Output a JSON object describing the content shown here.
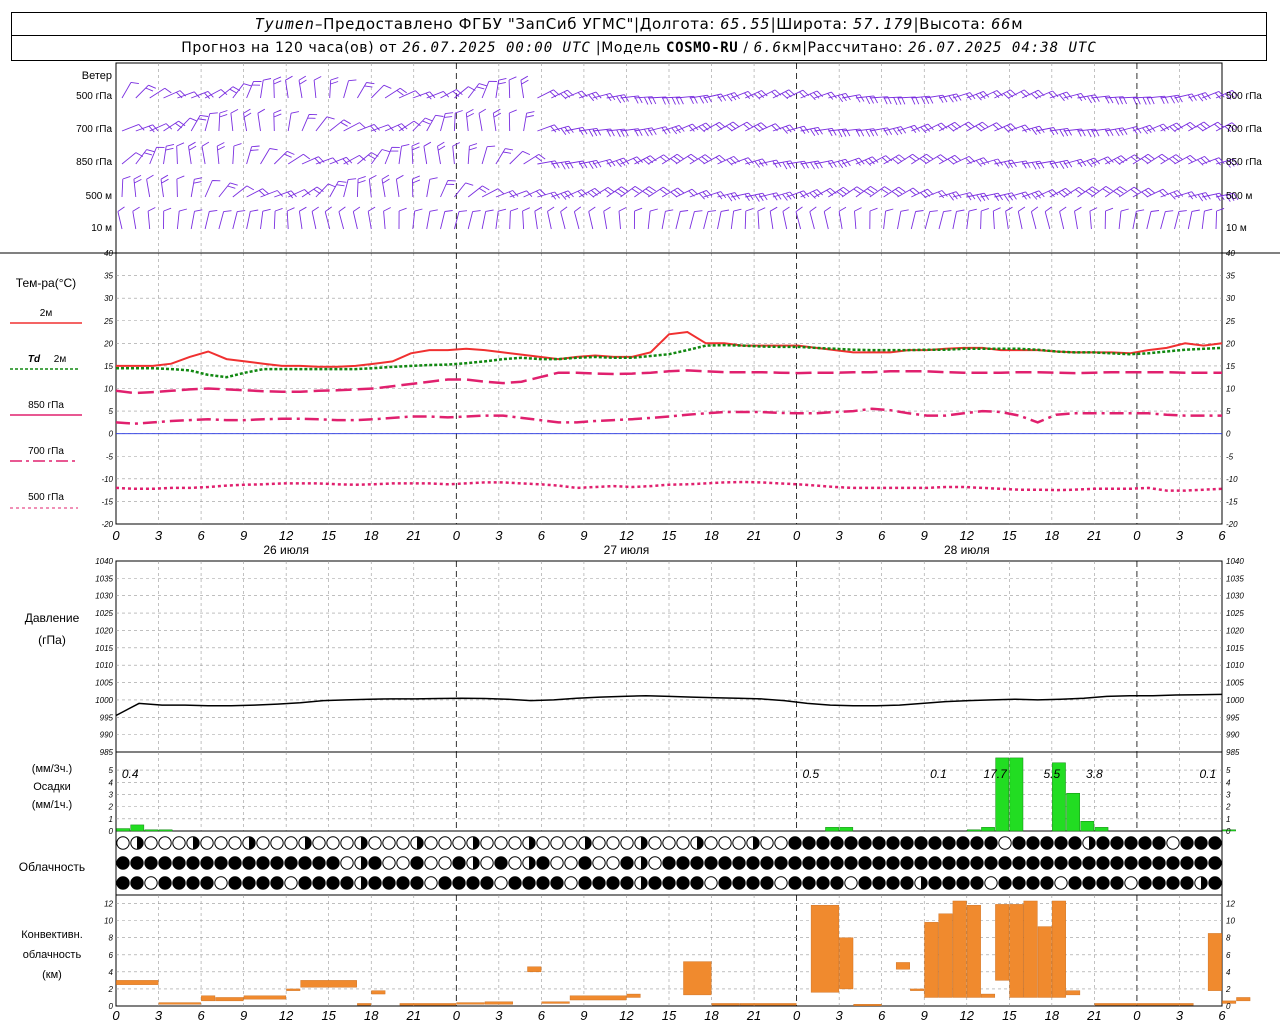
{
  "header": {
    "station": "Tyumen",
    "dash": " – ",
    "provider": "Предоставлено ФГБУ \"ЗапСиб УГМС\"",
    "lon_label": "Долгота:",
    "lon": "65.55",
    "lat_label": "Широта:",
    "lat": "57.179",
    "alt_label": "Высота:",
    "alt": "66",
    "alt_unit": "м",
    "sep": " | ",
    "forecast_label": "Прогноз на 120 часа(ов) от",
    "forecast_time": "26.07.2025 00:00 UTC",
    "model_label": "Модель",
    "model": "COSMO-RU",
    "resolution": "6.6",
    "res_unit": "км",
    "computed_label": "Рассчитано:",
    "computed_time": "26.07.2025 04:38 UTC"
  },
  "labels": {
    "wind": "Ветер",
    "wind_levels": [
      "500 гПа",
      "700 гПа",
      "850 гПа",
      "500 м",
      "10  м"
    ],
    "temp_title": "Тем-ра(°С)",
    "t2m": "2м",
    "td_a": "Td",
    "td_b": "2м",
    "t850": "850 гПа",
    "t700": "700 гПа",
    "t500": "500 гПа",
    "pressure_a": "Давление",
    "pressure_b": "(гПа)",
    "precip_a": "(мм/3ч.)",
    "precip_b": "Осадки",
    "precip_c": "(мм/1ч.)",
    "clouds": "Облачность",
    "conv_a": "Конвективн.",
    "conv_b": "облачность",
    "conv_c": "(км)"
  },
  "colors": {
    "wind": "#7a2ee0",
    "t2m": "#f03030",
    "td": "#118811",
    "t850": "#e0206e",
    "t700": "#e0206e",
    "t500": "#e0206e",
    "zero_line": "#2030e0",
    "precip": "#22dd22",
    "conv": "#f08a2e",
    "grid": "#999999"
  },
  "chart_data": [
    {
      "type": "line",
      "title": "Тем-ра(°С)",
      "x_ticks": [
        "0",
        "3",
        "6",
        "9",
        "12",
        "15",
        "18",
        "21",
        "0",
        "3",
        "6",
        "9",
        "12",
        "15",
        "18",
        "21",
        "0",
        "3",
        "6",
        "9",
        "12",
        "15",
        "18",
        "21",
        "0",
        "3",
        "6"
      ],
      "day_labels": [
        "26 июля",
        "27 июля",
        "28 июля"
      ],
      "ylim": [
        -20,
        40
      ],
      "yticks": [
        -20,
        -15,
        -10,
        -5,
        0,
        5,
        10,
        15,
        20,
        25,
        30,
        35,
        40
      ],
      "series": [
        {
          "name": "2м",
          "values": [
            15,
            15,
            15,
            15.5,
            17,
            18.2,
            16.5,
            16,
            15.5,
            15,
            15,
            14.8,
            14.8,
            15,
            15.5,
            16,
            17.8,
            18.5,
            18.5,
            18.8,
            18.5,
            18,
            17.5,
            17,
            16.5,
            17,
            17.3,
            17,
            17,
            18,
            22,
            22.5,
            20,
            20,
            19.5,
            19.5,
            19.5,
            19.5,
            19,
            18.5,
            18,
            18,
            18,
            18.5,
            18.5,
            18.8,
            19,
            19,
            18.5,
            18.5,
            18.5,
            18.2,
            18,
            18,
            18,
            17.8,
            18.5,
            19,
            20,
            19.5,
            20
          ]
        },
        {
          "name": "Td 2м",
          "values": [
            14.5,
            14.5,
            14.5,
            14.3,
            14,
            13,
            12.5,
            13.5,
            14.3,
            14.3,
            14.3,
            14.3,
            14.3,
            14.3,
            14.5,
            14.8,
            15,
            15.2,
            15.3,
            15.6,
            16,
            16.5,
            16.8,
            16.5,
            16.5,
            16.8,
            17,
            16.8,
            16.8,
            17.2,
            17.6,
            18.5,
            19.5,
            19.6,
            19.5,
            19.3,
            19.2,
            19.2,
            19,
            18.8,
            18.6,
            18.5,
            18.5,
            18.5,
            18.6,
            18.6,
            18.8,
            18.8,
            18.8,
            18.8,
            18.6,
            18.2,
            18,
            18,
            17.8,
            17.6,
            17.8,
            18.2,
            18.6,
            18.8,
            19
          ]
        },
        {
          "name": "850 гПа",
          "values": [
            9.5,
            9,
            9.2,
            9.5,
            9.8,
            10,
            9.8,
            9.6,
            9.4,
            9.3,
            9.3,
            9.5,
            9.6,
            9.8,
            10,
            10.5,
            11,
            11.5,
            12,
            12,
            11.5,
            11.2,
            11.5,
            12.5,
            13.5,
            13.5,
            13.3,
            13.2,
            13.3,
            13.5,
            13.8,
            14,
            13.8,
            13.6,
            13.6,
            13.6,
            13.5,
            13.4,
            13.5,
            13.5,
            13.6,
            13.6,
            13.8,
            13.8,
            13.8,
            13.6,
            13.5,
            13.5,
            13.5,
            13.6,
            13.6,
            13.5,
            13.4,
            13.5,
            13.6,
            13.6,
            13.6,
            13.6,
            13.5,
            13.5,
            13.5
          ]
        },
        {
          "name": "700 гПа",
          "values": [
            2.5,
            2.2,
            2.5,
            2.8,
            3,
            3.2,
            3,
            3,
            3.2,
            3.3,
            3.3,
            3.2,
            3,
            3,
            3.2,
            3.5,
            3.8,
            3.8,
            3.6,
            3.8,
            4,
            4,
            3.5,
            3,
            2.5,
            2.5,
            2.8,
            3,
            3.2,
            3.5,
            3.8,
            4.2,
            4.5,
            4.8,
            4.8,
            4.8,
            4.6,
            4.5,
            4.5,
            4.8,
            5,
            5.5,
            5.2,
            4.5,
            4,
            4,
            4.5,
            5,
            4.8,
            4,
            2.5,
            4.2,
            4.5,
            4.5,
            4.5,
            4.5,
            4.5,
            4.2,
            4,
            4,
            4
          ]
        },
        {
          "name": "500 гПа",
          "values": [
            -12,
            -12.2,
            -12.2,
            -12,
            -12,
            -11.8,
            -11.5,
            -11.3,
            -11.2,
            -11,
            -11,
            -11,
            -11.2,
            -11.3,
            -11.2,
            -11,
            -11,
            -11,
            -11.2,
            -11,
            -10.8,
            -10.8,
            -11,
            -11.2,
            -11.5,
            -12,
            -11.8,
            -11.6,
            -11.8,
            -11.6,
            -11.3,
            -11.2,
            -11,
            -10.8,
            -10.7,
            -10.8,
            -11,
            -11.2,
            -11.5,
            -11.8,
            -12,
            -12,
            -12,
            -12,
            -12,
            -11.8,
            -11.8,
            -12,
            -12.2,
            -12.4,
            -12.4,
            -12.5,
            -12.4,
            -12.2,
            -12.2,
            -12.2,
            -12,
            -12.6,
            -12.6,
            -12.4,
            -12.2
          ]
        }
      ]
    },
    {
      "type": "line",
      "title": "Давление",
      "ylabel": "(гПа)",
      "ylim": [
        985,
        1040
      ],
      "yticks": [
        985,
        990,
        995,
        1000,
        1005,
        1010,
        1015,
        1020,
        1025,
        1030,
        1035,
        1040
      ],
      "series": [
        {
          "name": "Давление",
          "values": [
            995.5,
            999,
            998.5,
            998.5,
            998.3,
            998.3,
            998.5,
            998.8,
            999.2,
            999.8,
            1000,
            1000.2,
            1000.3,
            1000.3,
            1000.4,
            1000.5,
            1000.4,
            1000.2,
            999.8,
            1000,
            1000.5,
            1000.8,
            1001,
            1001.2,
            1001,
            1000.8,
            1000.6,
            1000.5,
            1000.3,
            999.8,
            999,
            998.5,
            998.3,
            998.3,
            998.5,
            999,
            999.5,
            999.8,
            1000,
            1000.2,
            1000,
            1000.2,
            1000.5,
            1001,
            1001.2,
            1001.2,
            1001.4,
            1001.5,
            1001.6
          ]
        }
      ]
    },
    {
      "type": "bar",
      "title": "Осадки",
      "ylabel": "(мм/3ч.) (мм/1ч.)",
      "ylim": [
        0,
        5.5
      ],
      "yticks": [
        0,
        1,
        2,
        3,
        4,
        5
      ],
      "bars_mm_per_h": [
        [
          0,
          0.2
        ],
        [
          1,
          0.5
        ],
        [
          2,
          0.1
        ],
        [
          3,
          0.1
        ],
        [
          50,
          0.3
        ],
        [
          51,
          0.3
        ],
        [
          60,
          0.1
        ],
        [
          61,
          0.3
        ],
        [
          62,
          6
        ],
        [
          63,
          6
        ],
        [
          66,
          5.6
        ],
        [
          67,
          3.1
        ],
        [
          68,
          0.8
        ],
        [
          69,
          0.3
        ],
        [
          78,
          0.1
        ]
      ],
      "totals_3h": [
        {
          "hour": 1,
          "label": "0.4"
        },
        {
          "hour": 49,
          "label": "0.5"
        },
        {
          "hour": 58,
          "label": "0.1"
        },
        {
          "hour": 62,
          "label": "17.7"
        },
        {
          "hour": 66,
          "label": "5.5"
        },
        {
          "hour": 69,
          "label": "3.8"
        },
        {
          "hour": 77,
          "label": "0.1"
        }
      ]
    },
    {
      "type": "bar",
      "title": "Конвективн. облачность (км)",
      "ylim": [
        0,
        13
      ],
      "yticks": [
        0,
        2,
        4,
        6,
        8,
        10,
        12
      ],
      "layers": [
        [
          0,
          3,
          2.5,
          3
        ],
        [
          3,
          6,
          0.2,
          0.4
        ],
        [
          6,
          7,
          0.6,
          1.2
        ],
        [
          7,
          9,
          0.6,
          1
        ],
        [
          9,
          12,
          0.8,
          1.2
        ],
        [
          12,
          13,
          1.8,
          2
        ],
        [
          13,
          17,
          2.2,
          3
        ],
        [
          17,
          18,
          0.1,
          0.3
        ],
        [
          18,
          19,
          1.4,
          1.8
        ],
        [
          20,
          24,
          0.1,
          0.3
        ],
        [
          24,
          26,
          0.2,
          0.4
        ],
        [
          26,
          28,
          0.2,
          0.5
        ],
        [
          29,
          30,
          4,
          4.6
        ],
        [
          30,
          32,
          0.3,
          0.5
        ],
        [
          32,
          36,
          0.7,
          1.2
        ],
        [
          36,
          37,
          1,
          1.4
        ],
        [
          40,
          42,
          1.3,
          5.2
        ],
        [
          42,
          44,
          0.1,
          0.3
        ],
        [
          44,
          48,
          0.1,
          0.3
        ],
        [
          49,
          51,
          1.6,
          11.8
        ],
        [
          51,
          52,
          2,
          8
        ],
        [
          52,
          54,
          0.1,
          0.2
        ],
        [
          55,
          56,
          4.3,
          5.1
        ],
        [
          56,
          57,
          1.8,
          2
        ],
        [
          57,
          58,
          1,
          9.8
        ],
        [
          58,
          59,
          1,
          10.8
        ],
        [
          59,
          60,
          1,
          12.3
        ],
        [
          60,
          61,
          1,
          11.8
        ],
        [
          61,
          62,
          1,
          1.4
        ],
        [
          62,
          63,
          3,
          11.9
        ],
        [
          63,
          64,
          1,
          11.9
        ],
        [
          64,
          65,
          1,
          12.3
        ],
        [
          65,
          66,
          1,
          9.3
        ],
        [
          66,
          67,
          1,
          12.3
        ],
        [
          67,
          68,
          1.3,
          1.8
        ],
        [
          69,
          72,
          0.1,
          0.3
        ],
        [
          72,
          76,
          0.1,
          0.3
        ],
        [
          77,
          78,
          1.8,
          8.5
        ],
        [
          78,
          79,
          0.3,
          0.6
        ],
        [
          79,
          80,
          0.6,
          1
        ]
      ]
    }
  ],
  "x_axis": {
    "hours": [
      "0",
      "3",
      "6",
      "9",
      "12",
      "15",
      "18",
      "21",
      "0",
      "3",
      "6",
      "9",
      "12",
      "15",
      "18",
      "21",
      "0",
      "3",
      "6",
      "9",
      "12",
      "15",
      "18",
      "21",
      "0",
      "3",
      "6"
    ],
    "days": [
      "26 июля",
      "27 июля",
      "28 июля"
    ]
  }
}
